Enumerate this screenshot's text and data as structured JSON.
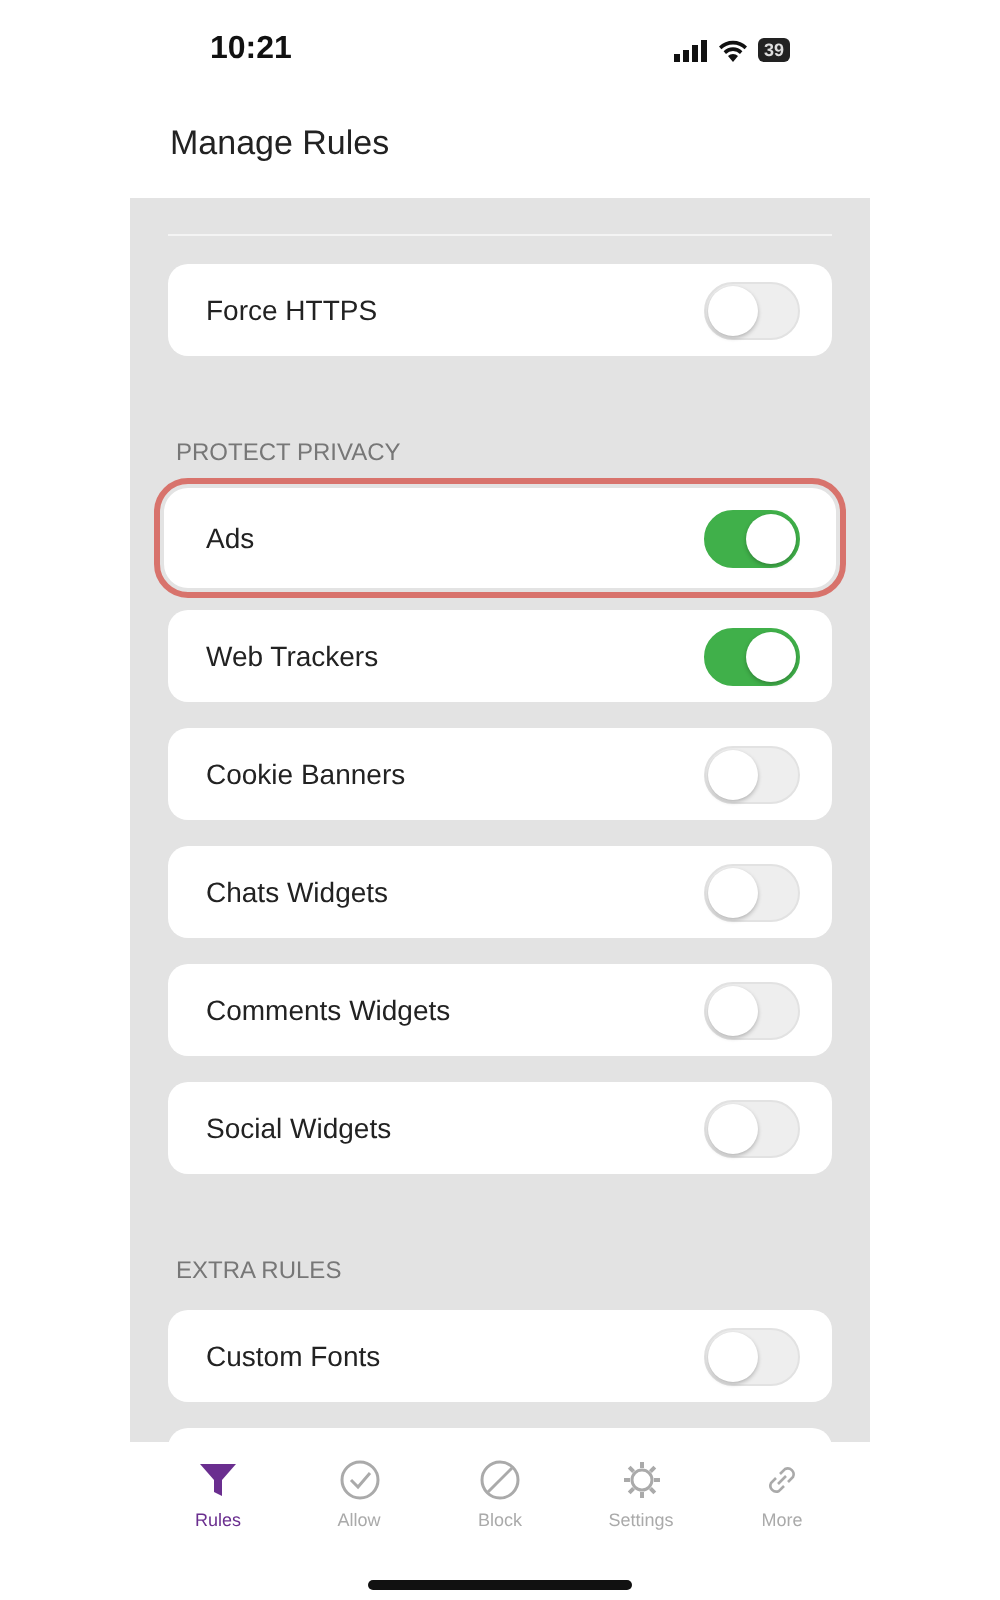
{
  "status_bar": {
    "time": "10:21",
    "battery": "39"
  },
  "title": "Manage Rules",
  "sections": [
    {
      "items": [
        {
          "label": "Force HTTPS",
          "on": false,
          "highlighted": false
        }
      ]
    },
    {
      "header": "PROTECT PRIVACY",
      "items": [
        {
          "label": "Ads",
          "on": true,
          "highlighted": true
        },
        {
          "label": "Web Trackers",
          "on": true,
          "highlighted": false
        },
        {
          "label": "Cookie Banners",
          "on": false,
          "highlighted": false
        },
        {
          "label": "Chats Widgets",
          "on": false,
          "highlighted": false
        },
        {
          "label": "Comments Widgets",
          "on": false,
          "highlighted": false
        },
        {
          "label": "Social Widgets",
          "on": false,
          "highlighted": false
        }
      ]
    },
    {
      "header": "EXTRA RULES",
      "items": [
        {
          "label": "Custom Fonts",
          "on": false,
          "highlighted": false
        }
      ]
    }
  ],
  "tabs": [
    {
      "label": "Rules",
      "kind": "funnel",
      "selected": true
    },
    {
      "label": "Allow",
      "kind": "check",
      "selected": false
    },
    {
      "label": "Block",
      "kind": "block",
      "selected": false
    },
    {
      "label": "Settings",
      "kind": "gear",
      "selected": false
    },
    {
      "label": "More",
      "kind": "link",
      "selected": false
    }
  ]
}
